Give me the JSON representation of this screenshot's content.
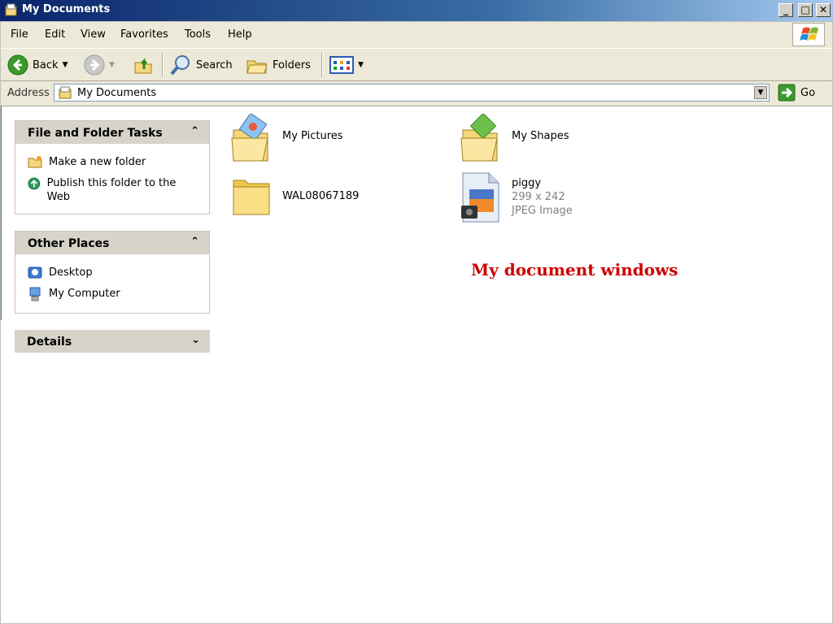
{
  "window": {
    "title": "My Documents"
  },
  "menu": {
    "items": [
      "File",
      "Edit",
      "View",
      "Favorites",
      "Tools",
      "Help"
    ]
  },
  "toolbar": {
    "back_label": "Back",
    "search_label": "Search",
    "folders_label": "Folders"
  },
  "address": {
    "label": "Address",
    "value": "My Documents",
    "go_label": "Go"
  },
  "tasks": {
    "file_folder": {
      "title": "File and Folder Tasks",
      "items": [
        "Make a new folder",
        "Publish this folder to the Web"
      ]
    },
    "other_places": {
      "title": "Other Places",
      "items": [
        "Desktop",
        "My Computer"
      ]
    },
    "details": {
      "title": "Details"
    }
  },
  "files": [
    {
      "name": "My Pictures"
    },
    {
      "name": "My Shapes"
    },
    {
      "name": "WAL08067189"
    },
    {
      "name": "piggy",
      "dimensions": "299 x 242",
      "type": "JPEG Image"
    }
  ],
  "caption": "My document windows",
  "colors": {
    "caption": "#cc0000",
    "titlebar": "#0a246a",
    "panel_header": "#d6d3c9"
  }
}
